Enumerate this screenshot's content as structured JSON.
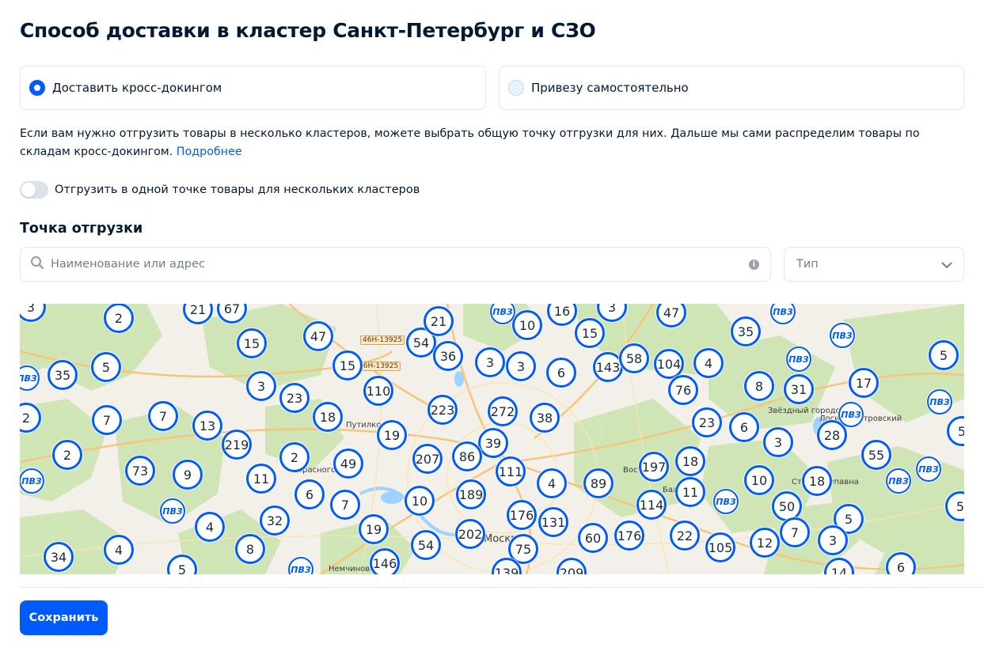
{
  "page": {
    "title": "Способ доставки в кластер Санкт-Петербург и СЗО"
  },
  "delivery_options": [
    {
      "label": "Доставить кросс-докингом",
      "selected": true
    },
    {
      "label": "Привезу самостоятельно",
      "selected": false
    }
  ],
  "info": {
    "text": "Если вам нужно отгрузить товары в несколько кластеров, можете выбрать общую точку отгрузки для них. Дальше мы сами распределим товары по складам кросс-докингом.",
    "link": "Подробнее"
  },
  "toggle": {
    "label": "Отгрузить в одной точке товары для нескольких кластеров",
    "on": false
  },
  "shipment_point": {
    "heading": "Точка отгрузки",
    "search_placeholder": "Наименование или адрес",
    "type_select": "Тип"
  },
  "map": {
    "marker_counts": [
      "3",
      "2",
      "21",
      "67",
      "47",
      "15",
      "54",
      "21",
      "36",
      "10",
      "16",
      "3",
      "15",
      "47",
      "35",
      "3",
      "5",
      "35",
      "15",
      "3",
      "23",
      "110",
      "223",
      "272",
      "38",
      "3",
      "6",
      "143",
      "58",
      "104",
      "4",
      "76",
      "8",
      "31",
      "17",
      "5",
      "2",
      "7",
      "7",
      "13",
      "18",
      "19",
      "219",
      "39",
      "23",
      "6",
      "2",
      "3",
      "28",
      "5",
      "2",
      "49",
      "207",
      "86",
      "111",
      "73",
      "9",
      "11",
      "6",
      "7",
      "4",
      "89",
      "197",
      "18",
      "55",
      "10",
      "18",
      "10",
      "189",
      "176",
      "131",
      "114",
      "11",
      "50",
      "5",
      "5",
      "32",
      "4",
      "19",
      "202",
      "54",
      "75",
      "60",
      "176",
      "22",
      "105",
      "12",
      "7",
      "3",
      "34",
      "4",
      "8",
      "5",
      "146",
      "139",
      "209",
      "14",
      "6"
    ],
    "pvz_label": "ПВЗ",
    "road_labels": [
      "46Н-13925",
      "46Н-13925"
    ],
    "place_labels": [
      "Путилко",
      "Москва",
      "Немчиново",
      "Лосино-Петровский",
      "Звёздный городок",
      "Красногорск",
      "Восточный",
      "Балашиха",
      "Старая Купавна"
    ]
  },
  "footer": {
    "save_label": "Сохранить"
  },
  "colors": {
    "accent": "#005bff",
    "text": "#001a34",
    "muted": "#707f8d",
    "border": "#e3e6ea"
  }
}
